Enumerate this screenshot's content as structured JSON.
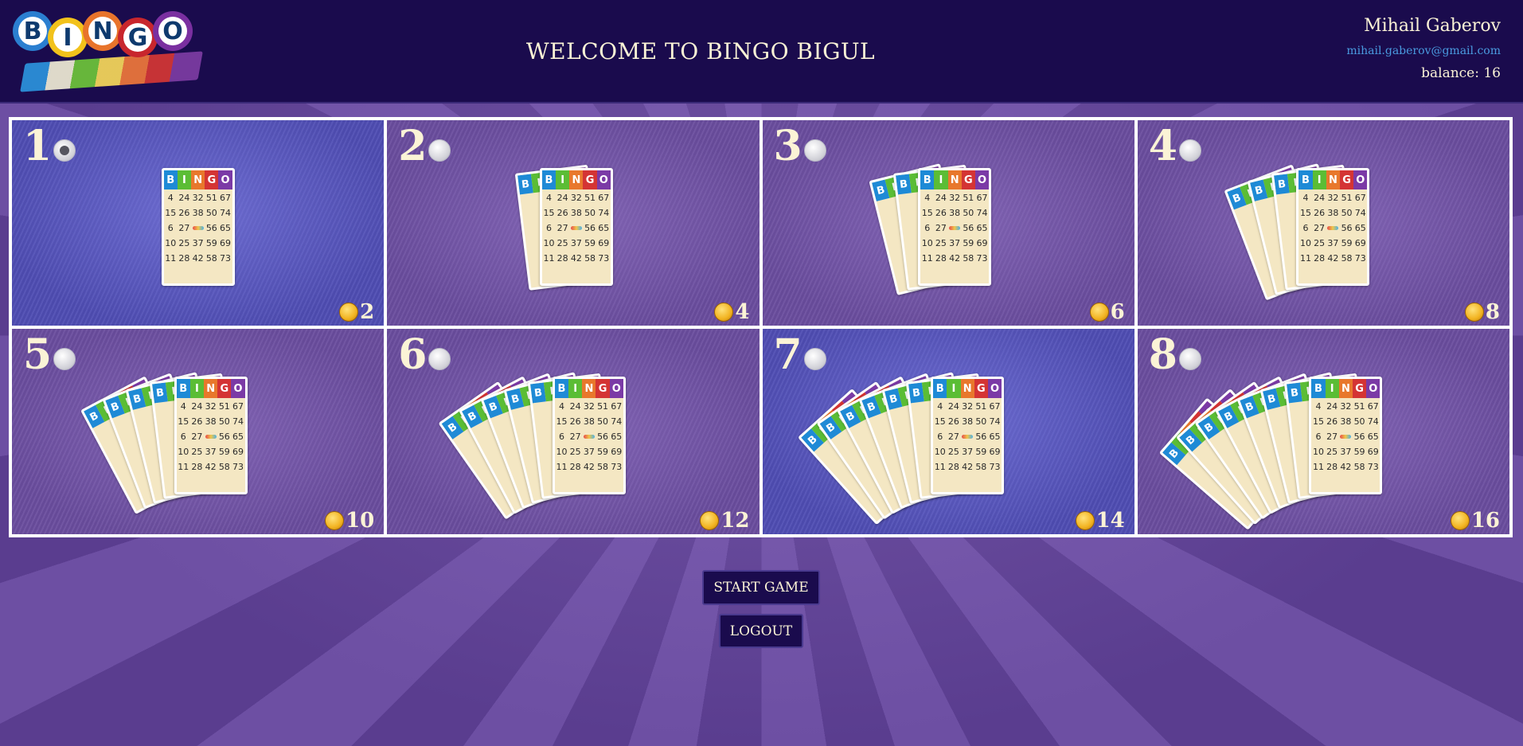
{
  "header": {
    "logo_letters": [
      "B",
      "I",
      "N",
      "G",
      "O"
    ],
    "logo_ball_colors": [
      "#2b7fd0",
      "#f2c21b",
      "#e8742b",
      "#c8262d",
      "#7a2fa0"
    ],
    "welcome": "WELCOME TO BINGO BIGUL",
    "user_name": "Mihail Gaberov",
    "user_email": "mihail.gaberov@gmail.com",
    "balance": "balance: 16"
  },
  "options": [
    {
      "number": "1",
      "price": "2",
      "selected": true
    },
    {
      "number": "2",
      "price": "4",
      "selected": false
    },
    {
      "number": "3",
      "price": "6",
      "selected": false
    },
    {
      "number": "4",
      "price": "8",
      "selected": false
    },
    {
      "number": "5",
      "price": "10",
      "selected": false
    },
    {
      "number": "6",
      "price": "12",
      "selected": false
    },
    {
      "number": "7",
      "price": "14",
      "selected": false
    },
    {
      "number": "8",
      "price": "16",
      "selected": false
    }
  ],
  "card": {
    "header": [
      "B",
      "I",
      "N",
      "G",
      "O"
    ],
    "numbers": [
      "4",
      "24",
      "32",
      "51",
      "67",
      "15",
      "26",
      "38",
      "50",
      "74",
      "6",
      "27",
      "",
      "56",
      "65",
      "10",
      "25",
      "37",
      "59",
      "69",
      "11",
      "28",
      "42",
      "58",
      "73"
    ]
  },
  "buttons": {
    "start": "START GAME",
    "logout": "LOGOUT"
  },
  "colors": {
    "header_bg": "#1a0b4d",
    "text_cream": "#fbf3d6",
    "email_blue": "#4a9be0"
  }
}
